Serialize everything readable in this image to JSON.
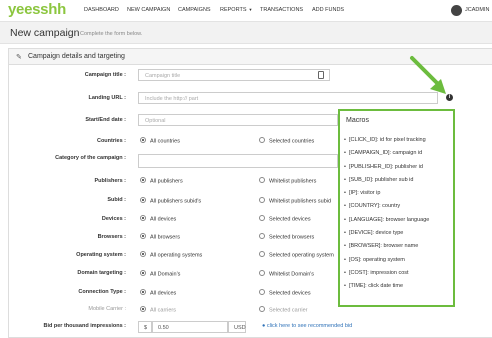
{
  "brand": {
    "logo": "yeesshh",
    "accent": "#8cc63f"
  },
  "nav": {
    "dashboard": "DASHBOARD",
    "new_campaign": "NEW CAMPAIGN",
    "campaigns": "CAMPAIGNS",
    "reports": "REPORTS",
    "transactions": "TRANSACTIONS",
    "add_funds": "ADD FUNDS",
    "user": "JCADMIN"
  },
  "page": {
    "title": "New campaign",
    "subtitle": "Complete the form below."
  },
  "panel": {
    "title": "Campaign details and targeting"
  },
  "form": {
    "campaign_title": {
      "label": "Campaign title :",
      "placeholder": "Campaign title"
    },
    "landing_url": {
      "label": "Landing URL :",
      "placeholder": "Include the http:// part"
    },
    "dates": {
      "label": "Start/End date :",
      "placeholder": "Optional"
    },
    "countries": {
      "label": "Countries :",
      "opt1": "All countries",
      "opt2": "Selected countries"
    },
    "category": {
      "label": "Category of the campaign :"
    },
    "publishers": {
      "label": "Publishers :",
      "opt1": "All publishers",
      "opt2": "Whitelist publishers"
    },
    "subid": {
      "label": "Subid :",
      "opt1": "All publishers subid's",
      "opt2": "Whitelist publishers subid"
    },
    "devices": {
      "label": "Devices :",
      "opt1": "All devices",
      "opt2": "Selected devices"
    },
    "browsers": {
      "label": "Browsers :",
      "opt1": "All browsers",
      "opt2": "Selected browsers"
    },
    "os": {
      "label": "Operating system :",
      "opt1": "All operating systems",
      "opt2": "Selected operating system"
    },
    "domain": {
      "label": "Domain targeting :",
      "opt1": "All Domain's",
      "opt2": "Whitelist Domain's"
    },
    "connection": {
      "label": "Connection Type :",
      "opt1": "All devices",
      "opt2": "Selected devices"
    },
    "carrier": {
      "label": "Mobile Carrier :",
      "opt1": "All carriers",
      "opt2": "Selected carrier"
    },
    "bid": {
      "label": "Bid per thousand impressions :",
      "currency": "$",
      "value": "0.50",
      "unit": "USD",
      "link": "click here to see recommended bid"
    }
  },
  "macros": {
    "title": "Macros",
    "items": [
      "[CLICK_ID]: id for pixel tracking",
      "[CAMPAIGN_ID]: campaign id",
      "[PUBLISHER_ID]: publisher id",
      "[SUB_ID]: publisher sub id",
      "[IP]: visitor ip",
      "[COUNTRY]: country",
      "[LANGUAGE]: browser language",
      "[DEVICE]: device type",
      "[BROWSER]: browser name",
      "[OS]: operating system",
      "[COST]: impression cost",
      "[TIME]: click date time"
    ]
  },
  "colors": {
    "highlight": "#6cbc3e",
    "link": "#2f72b8"
  }
}
